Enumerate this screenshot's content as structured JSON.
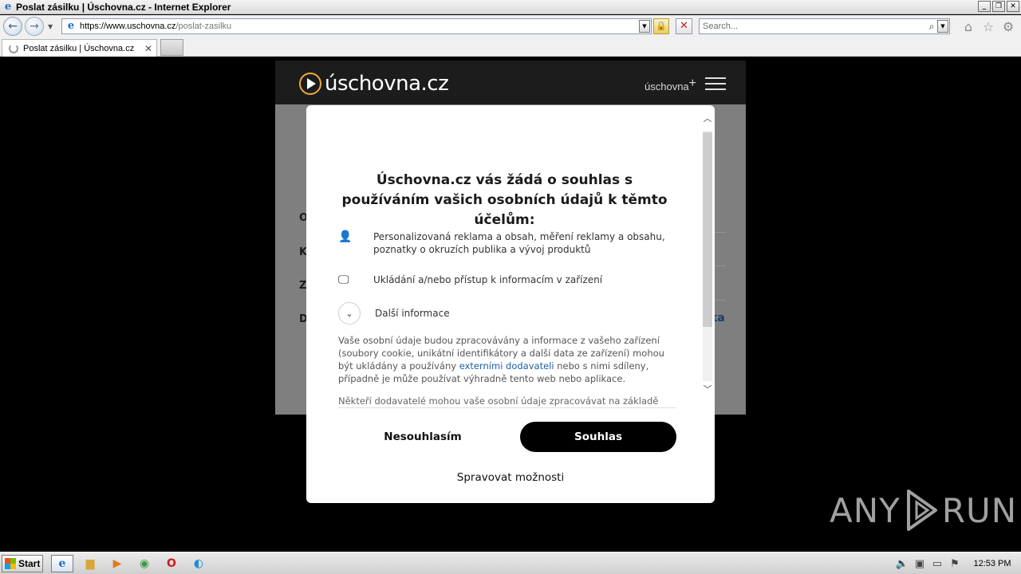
{
  "window": {
    "title": "Poslat zásilku | Úschovna.cz - Internet Explorer",
    "minimize_glyph": "_",
    "restore_glyph": "❐",
    "close_glyph": "✕"
  },
  "address_bar": {
    "url_prefix": "https://www.uschovna.cz",
    "url_path": "/poslat-zasilku",
    "search_placeholder": "Search..."
  },
  "tabs": [
    {
      "title": "Poslat zásilku | Úschovna.cz",
      "close": "✕"
    }
  ],
  "site": {
    "logo_text": "úschovna.cz",
    "plus_label": "úschovna",
    "plus_sign": "+",
    "form_letters": [
      "O",
      "K",
      "Z",
      "D"
    ],
    "partial_link": "ka"
  },
  "consent": {
    "title": "Úschovna.cz vás žádá o souhlas s používáním vašich osobních údajů k těmto účelům:",
    "purposes": [
      {
        "icon": "person-icon",
        "text": "Personalizovaná reklama a obsah, měření reklamy a obsahu, poznatky o okruzích publika a vývoj produktů"
      },
      {
        "icon": "devices-icon",
        "text": "Ukládání a/nebo přístup k informacím v zařízení"
      }
    ],
    "more_info_label": "Další informace",
    "description_part1": "Vaše osobní údaje budou zpracovávány a informace z vašeho zařízení (soubory cookie, unikátní identifikátory a další data ze zařízení) mohou být ukládány a používány ",
    "description_link": "externími dodavateli",
    "description_part2": " nebo s nimi sdíleny, případně je může používat výhradně tento web nebo aplikace.",
    "description_more": "Někteří dodavatelé mohou vaše osobní údaje zpracovávat na základě",
    "decline_label": "Nesouhlasím",
    "accept_label": "Souhlas",
    "manage_label": "Spravovat možnosti"
  },
  "watermark": {
    "left": "ANY",
    "right": "RUN"
  },
  "taskbar": {
    "start_label": "Start",
    "clock": "12:53 PM"
  },
  "colors": {
    "site_header": "#1c1c1c",
    "logo_accent": "#f0a93a",
    "accept_button": "#000000",
    "link": "#1e5fa6"
  }
}
